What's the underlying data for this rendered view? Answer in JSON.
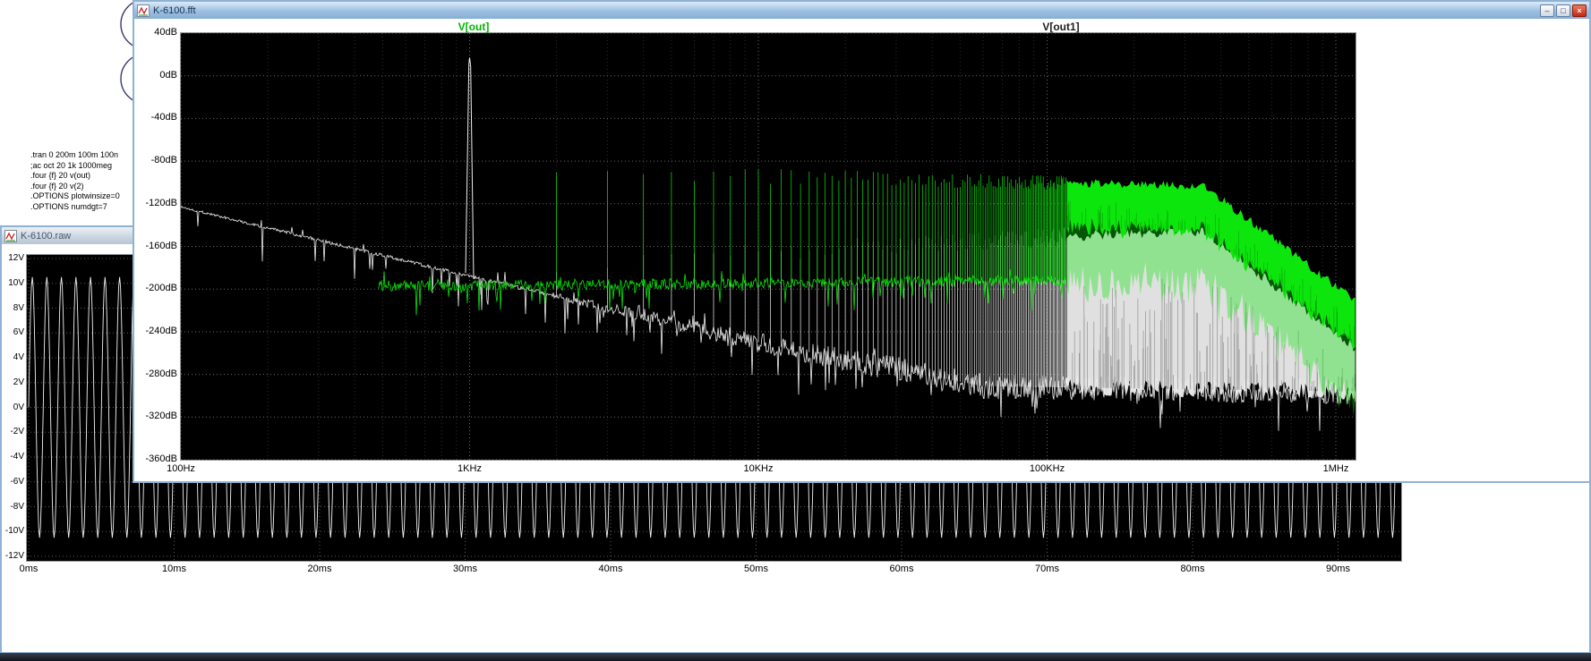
{
  "chrome": {
    "minimize": "–",
    "maximize": "□",
    "close": "×"
  },
  "fft": {
    "title": "K-6100.fft",
    "trace_labels": [
      {
        "text": "V[out]",
        "color": "#00b400",
        "x": 379
      },
      {
        "text": "V[out1]",
        "color": "#1d1d1d",
        "x": 1035
      }
    ]
  },
  "raw": {
    "title": "K-6100.raw"
  },
  "schematic": {
    "directives": [
      ".tran 0 200m 100m 100n",
      ";ac oct 20 1k 1000meg",
      ".four {f} 20 v(out)",
      ".four {f} 20 v(2)",
      ".OPTIONS plotwinsize=0",
      ".OPTIONS numdgt=7"
    ]
  },
  "chart_data": [
    {
      "type": "line",
      "title": "K-6100.fft",
      "x_axis": {
        "scale": "log",
        "min_hz": 100,
        "max_hz": 1170000,
        "tick_hz": [
          100,
          1000,
          10000,
          100000,
          1000000
        ],
        "tick_labels": [
          "100Hz",
          "1KHz",
          "10KHz",
          "100KHz",
          "1MHz"
        ]
      },
      "y_axis": {
        "unit": "dB",
        "max_db": 40,
        "min_db": -360,
        "step_db": 40,
        "tick_labels": [
          "40dB",
          "0dB",
          "-40dB",
          "-80dB",
          "-120dB",
          "-160dB",
          "-200dB",
          "-240dB",
          "-280dB",
          "-320dB",
          "-360dB"
        ]
      },
      "series": [
        {
          "name": "V[out1]",
          "color": "#efefef",
          "description": "FFT: 1kHz fundamental at +17dB; sloping baseline -123dB@100Hz to -250dB@10kHz; noise floor near -291dB above 60kHz; dense harmonic band topping near -146dB between 150k-350kHz, rolling off to about -250dB at 1MHz",
          "fundamental": {
            "hz": 1000,
            "peak_db": 17
          },
          "baseline_db_points": [
            [
              100,
              -123
            ],
            [
              1000,
              -188
            ],
            [
              10000,
              -250
            ],
            [
              60000,
              -291
            ],
            [
              1170000,
              -296
            ]
          ],
          "noise_amp_db_points": [
            [
              100,
              1.2
            ],
            [
              1500,
              1.8
            ],
            [
              4000,
              6
            ],
            [
              10000,
              9
            ],
            [
              30000,
              12
            ],
            [
              1170000,
              12
            ]
          ],
          "harmonic_env": {
            "base_db": -180,
            "slope_db_per_log10n": 14,
            "cap_db": -146,
            "rolloff_hz": 350000,
            "rolloff_db_per_decade": 210,
            "jitter_db": 9
          },
          "harmonic_spacing_hz": 1000,
          "dense_from_n": 117
        },
        {
          "name": "V[out]",
          "color": "#0ce60c",
          "description": "FFT: noise floor ~-197dB from ~500Hz; 1kHz-harmonic spikes up to ~-88dB; harmonics merge into solid band (-96 to -140dB) above ~117kHz; band rolls off above 350kHz to ~-210dB at 1MHz",
          "start_hz": 480,
          "floor_db_points": [
            [
              480,
              -197
            ],
            [
              1000,
              -197
            ],
            [
              1170000,
              -189
            ]
          ],
          "noise_amp_db": 5,
          "harmonic_env": {
            "base_db": -88,
            "slope_db_per_log10n": -6,
            "cap_db": null,
            "rolloff_hz": 350000,
            "rolloff_db_per_decade": 200,
            "jitter_db": 7
          },
          "band_thickness_db": 42,
          "underglow_db": 52,
          "harmonic_spacing_hz": 1000,
          "dense_from_n": 117
        }
      ]
    },
    {
      "type": "line",
      "title": "K-6100.raw",
      "x_axis": {
        "unit": "ms",
        "max_ms": 94.3,
        "tick_ms": [
          0,
          10,
          20,
          30,
          40,
          50,
          60,
          70,
          80,
          90
        ],
        "tick_labels": [
          "0ms",
          "10ms",
          "20ms",
          "30ms",
          "40ms",
          "50ms",
          "60ms",
          "70ms",
          "80ms",
          "90ms"
        ]
      },
      "y_axis": {
        "unit": "V",
        "max_v": 12,
        "min_v": -12,
        "step_v": 2,
        "tick_labels": [
          "12V",
          "10V",
          "8V",
          "6V",
          "4V",
          "2V",
          "0V",
          "-2V",
          "-4V",
          "-6V",
          "-8V",
          "-10V",
          "-12V"
        ]
      },
      "series": [
        {
          "name": "V(out)",
          "color": "#f2f2f2",
          "waveform": "sine",
          "frequency_hz": 1000,
          "amplitude_v": 10.5,
          "offset_v": 0
        }
      ]
    }
  ]
}
